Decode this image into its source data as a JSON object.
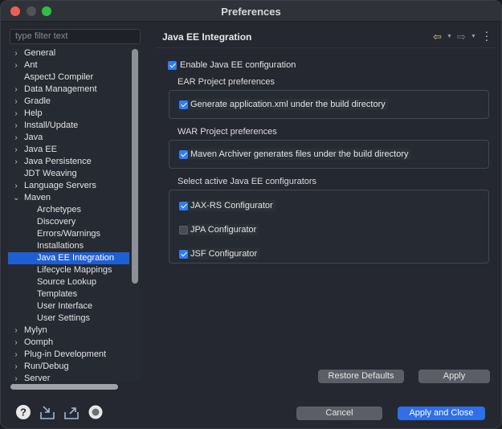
{
  "window": {
    "title": "Preferences"
  },
  "filter": {
    "placeholder": "type filter text"
  },
  "tree": {
    "items": [
      {
        "label": "General",
        "chevron": "›",
        "indent": 0
      },
      {
        "label": "Ant",
        "chevron": "›",
        "indent": 0
      },
      {
        "label": "AspectJ Compiler",
        "chevron": "",
        "indent": 0
      },
      {
        "label": "Data Management",
        "chevron": "›",
        "indent": 0
      },
      {
        "label": "Gradle",
        "chevron": "›",
        "indent": 0
      },
      {
        "label": "Help",
        "chevron": "›",
        "indent": 0
      },
      {
        "label": "Install/Update",
        "chevron": "›",
        "indent": 0
      },
      {
        "label": "Java",
        "chevron": "›",
        "indent": 0
      },
      {
        "label": "Java EE",
        "chevron": "›",
        "indent": 0
      },
      {
        "label": "Java Persistence",
        "chevron": "›",
        "indent": 0
      },
      {
        "label": "JDT Weaving",
        "chevron": "",
        "indent": 0
      },
      {
        "label": "Language Servers",
        "chevron": "›",
        "indent": 0
      },
      {
        "label": "Maven",
        "chevron": "⌄",
        "indent": 0
      },
      {
        "label": "Archetypes",
        "chevron": "",
        "indent": 1
      },
      {
        "label": "Discovery",
        "chevron": "",
        "indent": 1
      },
      {
        "label": "Errors/Warnings",
        "chevron": "",
        "indent": 1
      },
      {
        "label": "Installations",
        "chevron": "",
        "indent": 1
      },
      {
        "label": "Java EE Integration",
        "chevron": "",
        "indent": 1,
        "selected": true
      },
      {
        "label": "Lifecycle Mappings",
        "chevron": "",
        "indent": 1
      },
      {
        "label": "Source Lookup",
        "chevron": "",
        "indent": 1
      },
      {
        "label": "Templates",
        "chevron": "",
        "indent": 1
      },
      {
        "label": "User Interface",
        "chevron": "",
        "indent": 1
      },
      {
        "label": "User Settings",
        "chevron": "",
        "indent": 1
      },
      {
        "label": "Mylyn",
        "chevron": "›",
        "indent": 0
      },
      {
        "label": "Oomph",
        "chevron": "›",
        "indent": 0
      },
      {
        "label": "Plug-in Development",
        "chevron": "›",
        "indent": 0
      },
      {
        "label": "Run/Debug",
        "chevron": "›",
        "indent": 0
      },
      {
        "label": "Server",
        "chevron": "›",
        "indent": 0
      }
    ]
  },
  "page": {
    "title": "Java EE Integration",
    "nav_back_icon": "back-arrow-icon",
    "nav_forward_icon": "forward-arrow-icon",
    "menu_icon": "more-vertical-icon",
    "enable_label": "Enable Java EE configuration",
    "enable_checked": true,
    "ear_section": "EAR Project preferences",
    "ear_option": "Generate application.xml under the build directory",
    "ear_checked": true,
    "war_section": "WAR Project preferences",
    "war_option": "Maven Archiver generates files under the build directory",
    "war_checked": true,
    "configurators_section": "Select active Java EE configurators",
    "configurators": [
      {
        "label": "JAX-RS Configurator",
        "checked": true
      },
      {
        "label": "JPA Configurator",
        "checked": false
      },
      {
        "label": "JSF Configurator",
        "checked": true
      }
    ],
    "restore_defaults": "Restore Defaults",
    "apply": "Apply"
  },
  "footer": {
    "icons": [
      "help-icon",
      "import-icon",
      "export-icon",
      "record-icon"
    ],
    "cancel": "Cancel",
    "apply_and_close": "Apply and Close"
  },
  "colors": {
    "accent": "#2f6fe8",
    "selection": "#1f5fd4",
    "checkbox": "#2f7cf6",
    "back_arrow": "#e9c46a"
  }
}
